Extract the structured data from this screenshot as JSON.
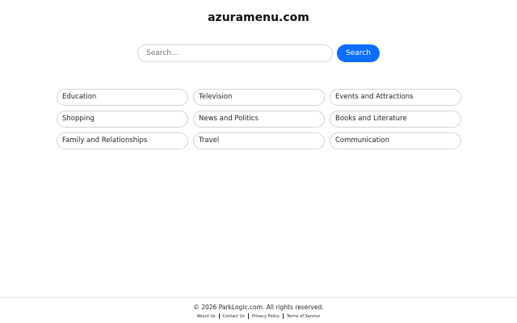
{
  "site": {
    "title": "azuramenu.com"
  },
  "search": {
    "placeholder": "Search...",
    "button_label": "Search"
  },
  "categories": [
    "Education",
    "Television",
    "Events and Attractions",
    "Shopping",
    "News and Politics",
    "Books and Literature",
    "Family and Relationships",
    "Travel",
    "Communication"
  ],
  "footer": {
    "copyright": "© 2026 ParkLogic.com. All rights reserved.",
    "links": [
      "About Us",
      "Contact Us",
      "Privacy Policy",
      "Terms of Service"
    ]
  }
}
